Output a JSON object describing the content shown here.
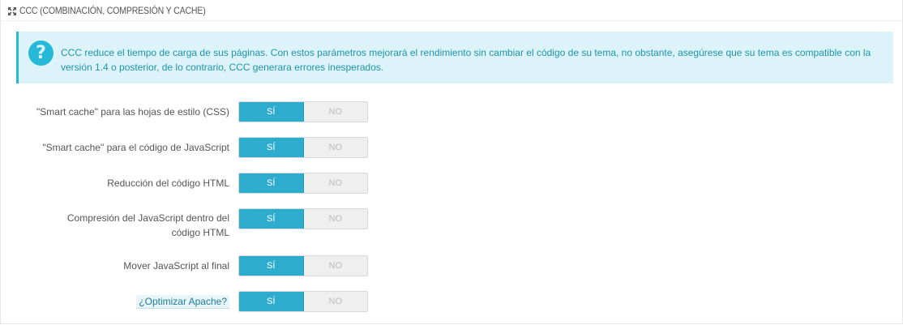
{
  "panel": {
    "title": "CCC (COMBINACIÓN, COMPRESIÓN Y CACHE)",
    "icon": "expand-arrows-icon"
  },
  "alert": {
    "icon": "question-circle-icon",
    "color": "#25b9d7",
    "text": "CCC reduce el tiempo de carga de sus páginas. Con estos parámetros mejorará el rendimiento sin cambiar el código de su tema, no obstante, asegúrese que su tema es compatible con la versión 1.4 o posterior, de lo contrario, CCC generara errores inesperados."
  },
  "settings": [
    {
      "label": "\"Smart cache\" para las hojas de estilo (CSS)",
      "yes": "SÍ",
      "no": "NO",
      "value": "yes"
    },
    {
      "label": "\"Smart cache\" para el código de JavaScript",
      "yes": "SÍ",
      "no": "NO",
      "value": "yes"
    },
    {
      "label": "Reducción del código HTML",
      "yes": "SÍ",
      "no": "NO",
      "value": "yes"
    },
    {
      "label": "Compresión del JavaScript dentro del código HTML",
      "yes": "SÍ",
      "no": "NO",
      "value": "yes"
    },
    {
      "label": "Mover JavaScript al final",
      "yes": "SÍ",
      "no": "NO",
      "value": "yes"
    },
    {
      "label": "¿Optimizar Apache?",
      "yes": "SÍ",
      "no": "NO",
      "value": "yes"
    }
  ]
}
